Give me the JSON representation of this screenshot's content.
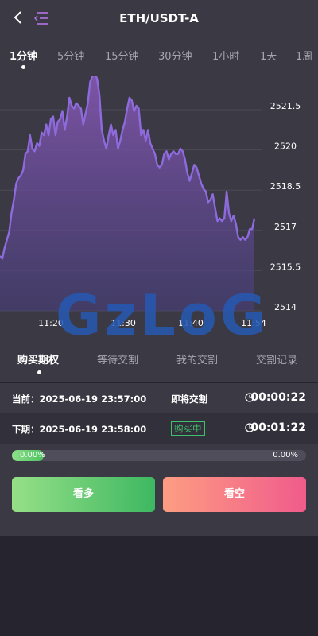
{
  "header": {
    "title": "ETH/USDT-A"
  },
  "timeframes": [
    {
      "label": "1分钟",
      "active": true
    },
    {
      "label": "5分钟"
    },
    {
      "label": "15分钟"
    },
    {
      "label": "30分钟"
    },
    {
      "label": "1小时"
    },
    {
      "label": "1天"
    },
    {
      "label": "1周"
    }
  ],
  "chart_data": {
    "type": "area",
    "y_ticks": [
      "2521.5",
      "2520",
      "2518.5",
      "2517",
      "2515.5",
      "2514"
    ],
    "x_ticks": [
      "11:20",
      "11:30",
      "11:40",
      "11:54"
    ],
    "ylim": [
      2514,
      2521.5
    ],
    "grid": true,
    "line_color": "#8e6bdc",
    "values": [
      2515.9,
      2515.8,
      2516.2,
      2516.5,
      2516.8,
      2517.5,
      2518,
      2518.6,
      2518.8,
      2518.9,
      2519.1,
      2519.7,
      2519.8,
      2520.4,
      2519.9,
      2519.8,
      2520.1,
      2520,
      2520.5,
      2520.4,
      2520.8,
      2520.4,
      2521,
      2521.1,
      2520.4,
      2520.9,
      2521,
      2521.3,
      2520.6,
      2521.1,
      2521.8,
      2521.5,
      2521.4,
      2521.6,
      2521.5,
      2521.4,
      2520.8,
      2521.2,
      2521.6,
      2522.4,
      2522.6,
      2522.7,
      2522.5,
      2521.9,
      2520.6,
      2520.2,
      2519.9,
      2520.4,
      2520.8,
      2520.4,
      2520.6,
      2519.9,
      2520.2,
      2520.6,
      2520.9,
      2521.4,
      2521.8,
      2521.7,
      2521.3,
      2521.5,
      2521.4,
      2520.4,
      2520.6,
      2520.2,
      2520.6,
      2520.1,
      2519.9,
      2519.7,
      2519.3,
      2519.2,
      2519.3,
      2519.7,
      2519.8,
      2519.5,
      2519.7,
      2519.8,
      2519.7,
      2519.7,
      2519.9,
      2519.8,
      2519.5,
      2519,
      2518.7,
      2519,
      2519.3,
      2519.2,
      2518.9,
      2518.6,
      2518.4,
      2518.3,
      2517.9,
      2518,
      2518.2,
      2517.7,
      2517.2,
      2517.3,
      2517.2,
      2517.3,
      2518.3,
      2517.5,
      2517.2,
      2517.4,
      2517.1,
      2516.6,
      2516.5,
      2516.6,
      2516.5,
      2516.6,
      2516.9,
      2516.9,
      2517.3
    ]
  },
  "tabs": [
    {
      "label": "购买期权",
      "active": true
    },
    {
      "label": "等待交割"
    },
    {
      "label": "我的交割"
    },
    {
      "label": "交割记录"
    }
  ],
  "current_period": {
    "label": "当前：2025-06-19 23:57:00",
    "status": "即将交割",
    "countdown": "00:00:22"
  },
  "next_period": {
    "label": "下期：2025-06-19 23:58:00",
    "status": "购买中",
    "countdown": "00:01:22"
  },
  "progress": {
    "left": "0.00%",
    "right": "0.00%",
    "fill": 0.0
  },
  "actions": {
    "buy_up": "看多",
    "buy_down": "看空"
  },
  "watermark": "GzLoG",
  "colors": {
    "accent": "#8e6bdc",
    "up": "#3eb862",
    "down": "#f05b8c",
    "buying": "#3fc06a"
  }
}
